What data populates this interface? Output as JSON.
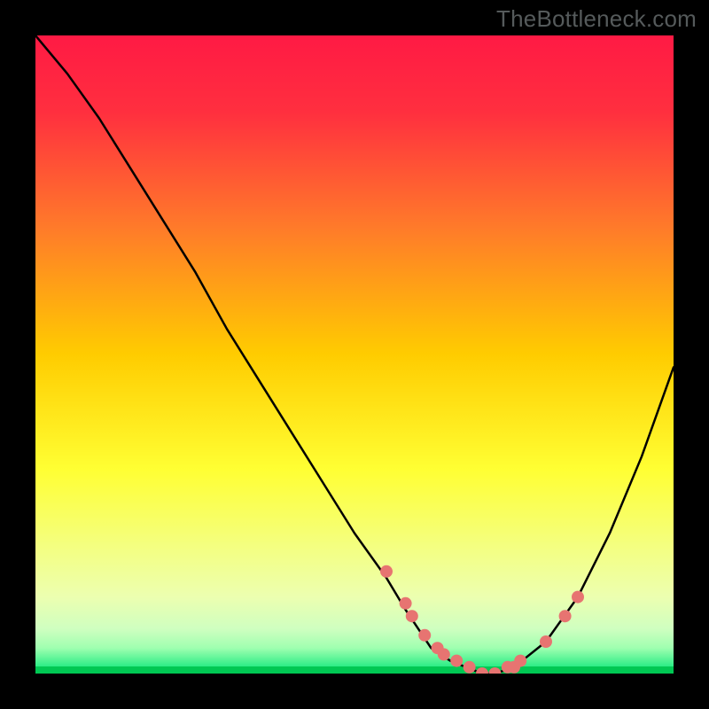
{
  "watermark": "TheBottleneck.com",
  "chart_data": {
    "type": "line",
    "title": "",
    "xlabel": "",
    "ylabel": "",
    "xlim": [
      0,
      100
    ],
    "ylim": [
      0,
      100
    ],
    "background_gradient": [
      "#ff1a44",
      "#ffcc00",
      "#ffff66",
      "#e6ff99",
      "#00e676"
    ],
    "series": [
      {
        "name": "curve",
        "x": [
          0,
          5,
          10,
          15,
          20,
          25,
          30,
          35,
          40,
          45,
          50,
          55,
          58,
          60,
          62,
          65,
          70,
          72,
          75,
          80,
          85,
          90,
          95,
          100
        ],
        "values": [
          100,
          94,
          87,
          79,
          71,
          63,
          54,
          46,
          38,
          30,
          22,
          15,
          10,
          7,
          4,
          2,
          0,
          0,
          1,
          5,
          12,
          22,
          34,
          48
        ]
      }
    ],
    "scatter": {
      "name": "highlight-points",
      "color": "#e77471",
      "x": [
        55,
        58,
        59,
        61,
        63,
        64,
        66,
        68,
        70,
        72,
        74,
        75,
        76,
        80,
        83,
        85
      ],
      "values": [
        16,
        11,
        9,
        6,
        4,
        3,
        2,
        1,
        0,
        0,
        1,
        1,
        2,
        5,
        9,
        12
      ]
    }
  }
}
